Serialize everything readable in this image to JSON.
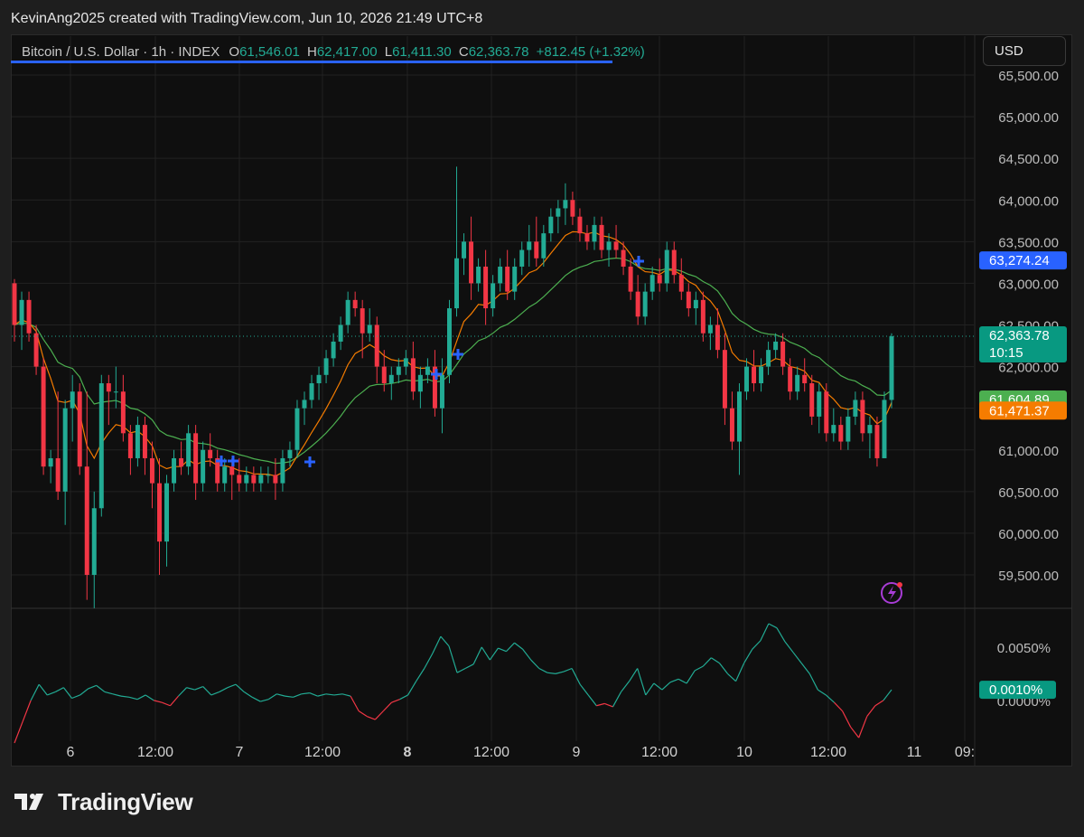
{
  "header": {
    "credit": "KevinAng2025 created with TradingView.com, Jun 10, 2026 21:49 UTC+8"
  },
  "legend": {
    "symbol": "Bitcoin / U.S. Dollar · 1h · INDEX",
    "o_label": "O",
    "o_value": "61,546.01",
    "h_label": "H",
    "h_value": "62,417.00",
    "l_label": "L",
    "l_value": "61,411.30",
    "c_label": "C",
    "c_value": "62,363.78",
    "change": "+812.45 (+1.32%)"
  },
  "currency_button": "USD",
  "brand": "TradingView",
  "chart_data": [
    {
      "type": "candlestick",
      "title": "Bitcoin / U.S. Dollar · 1h · INDEX",
      "y_ticks": [
        "65,500.00",
        "65,000.00",
        "64,500.00",
        "64,000.00",
        "63,500.00",
        "63,000.00",
        "62,500.00",
        "62,000.00",
        "61,500.00",
        "61,000.00",
        "60,500.00",
        "60,000.00",
        "59,500.00"
      ],
      "x_ticks": [
        "6",
        "12:00",
        "7",
        "12:00",
        "8",
        "12:00",
        "9",
        "12:00",
        "10",
        "12:00",
        "11",
        "09:"
      ],
      "ylim": [
        59200,
        65600
      ],
      "price_tags": [
        {
          "label": "63,274.24",
          "value": 63274.24,
          "color": "#2962ff"
        },
        {
          "label": "62,363.78",
          "sub": "10:15",
          "value": 62363.78,
          "color": "#089981"
        },
        {
          "label": "61,604.89",
          "value": 61604.89,
          "color": "#4caf50"
        },
        {
          "label": "61,471.37",
          "value": 61471.37,
          "color": "#f57c00"
        }
      ],
      "colors": {
        "up": "#22ab94",
        "down": "#f23645",
        "ma_fast": "#f57c00",
        "ma_slow": "#4caf50",
        "cross": "#2962ff"
      },
      "candles": [
        [
          63000,
          63050,
          62300,
          62500
        ],
        [
          62500,
          62900,
          62200,
          62800
        ],
        [
          62800,
          62900,
          62300,
          62400
        ],
        [
          62400,
          62500,
          61900,
          62000
        ],
        [
          62000,
          62100,
          60700,
          60800
        ],
        [
          60800,
          61000,
          60600,
          60900
        ],
        [
          60900,
          61700,
          60400,
          60500
        ],
        [
          60500,
          61600,
          60100,
          61500
        ],
        [
          61500,
          61900,
          61100,
          61700
        ],
        [
          61700,
          61800,
          60700,
          60800
        ],
        [
          60800,
          61700,
          59200,
          59500
        ],
        [
          59500,
          60500,
          59100,
          60300
        ],
        [
          60300,
          61900,
          60200,
          61800
        ],
        [
          61800,
          61900,
          61300,
          61700
        ],
        [
          61700,
          62000,
          61500,
          61700
        ],
        [
          61700,
          61900,
          61100,
          61200
        ],
        [
          61200,
          61300,
          60700,
          60900
        ],
        [
          60900,
          61400,
          60800,
          61300
        ],
        [
          61300,
          61400,
          60700,
          60900
        ],
        [
          60900,
          61100,
          60300,
          60600
        ],
        [
          60600,
          60900,
          59500,
          59900
        ],
        [
          59900,
          60700,
          59600,
          60600
        ],
        [
          60600,
          61000,
          60500,
          60900
        ],
        [
          60900,
          61100,
          60700,
          60800
        ],
        [
          60800,
          61300,
          60700,
          61200
        ],
        [
          61200,
          61300,
          60400,
          60600
        ],
        [
          60600,
          61100,
          60500,
          61000
        ],
        [
          61000,
          61200,
          60800,
          60900
        ],
        [
          60900,
          61000,
          60500,
          60600
        ],
        [
          60600,
          60900,
          60500,
          60800
        ],
        [
          60800,
          60900,
          60400,
          60700
        ],
        [
          60700,
          60900,
          60500,
          60600
        ],
        [
          60600,
          60800,
          60500,
          60700
        ],
        [
          60700,
          60800,
          60500,
          60600
        ],
        [
          60600,
          60800,
          60500,
          60700
        ],
        [
          60700,
          60800,
          60600,
          60700
        ],
        [
          60700,
          60900,
          60400,
          60600
        ],
        [
          60600,
          61000,
          60500,
          60900
        ],
        [
          60900,
          61100,
          60800,
          61000
        ],
        [
          61000,
          61600,
          60900,
          61500
        ],
        [
          61500,
          61700,
          61300,
          61600
        ],
        [
          61600,
          61900,
          61500,
          61800
        ],
        [
          61800,
          62000,
          61600,
          61900
        ],
        [
          61900,
          62200,
          61800,
          62100
        ],
        [
          62100,
          62400,
          62000,
          62300
        ],
        [
          62300,
          62600,
          62200,
          62500
        ],
        [
          62500,
          62900,
          62400,
          62800
        ],
        [
          62800,
          62900,
          62600,
          62700
        ],
        [
          62700,
          62800,
          62100,
          62400
        ],
        [
          62400,
          62700,
          62300,
          62500
        ],
        [
          62500,
          62600,
          61800,
          62000
        ],
        [
          62000,
          62200,
          61700,
          61800
        ],
        [
          61800,
          62000,
          61600,
          61900
        ],
        [
          61900,
          62100,
          61800,
          62000
        ],
        [
          62000,
          62200,
          61900,
          62100
        ],
        [
          62100,
          62300,
          61600,
          61700
        ],
        [
          61700,
          62000,
          61500,
          61900
        ],
        [
          61900,
          62100,
          61800,
          62000
        ],
        [
          62000,
          62200,
          61400,
          61500
        ],
        [
          61500,
          62100,
          61200,
          61900
        ],
        [
          61900,
          62800,
          61800,
          62700
        ],
        [
          62700,
          64400,
          62600,
          63300
        ],
        [
          63300,
          63600,
          63100,
          63500
        ],
        [
          63500,
          63800,
          62800,
          63000
        ],
        [
          63000,
          63300,
          62900,
          63200
        ],
        [
          63200,
          63400,
          62500,
          62700
        ],
        [
          62700,
          63100,
          62600,
          63000
        ],
        [
          63000,
          63300,
          62900,
          63200
        ],
        [
          63200,
          63400,
          62800,
          62900
        ],
        [
          62900,
          63300,
          62800,
          63200
        ],
        [
          63200,
          63500,
          63100,
          63400
        ],
        [
          63400,
          63700,
          63200,
          63500
        ],
        [
          63500,
          63800,
          63200,
          63300
        ],
        [
          63300,
          63700,
          63200,
          63600
        ],
        [
          63600,
          63900,
          63500,
          63800
        ],
        [
          63800,
          64000,
          63600,
          63900
        ],
        [
          63900,
          64200,
          63700,
          64000
        ],
        [
          64000,
          64100,
          63700,
          63800
        ],
        [
          63800,
          63900,
          63500,
          63600
        ],
        [
          63600,
          63700,
          63400,
          63500
        ],
        [
          63500,
          63800,
          63400,
          63700
        ],
        [
          63700,
          63800,
          63300,
          63400
        ],
        [
          63400,
          63600,
          63200,
          63500
        ],
        [
          63500,
          63700,
          63300,
          63400
        ],
        [
          63400,
          63500,
          63100,
          63200
        ],
        [
          63200,
          63300,
          62800,
          62900
        ],
        [
          62900,
          63100,
          62500,
          62600
        ],
        [
          62600,
          63000,
          62500,
          62900
        ],
        [
          62900,
          63200,
          62800,
          63100
        ],
        [
          63100,
          63300,
          62900,
          63000
        ],
        [
          63000,
          63500,
          62900,
          63400
        ],
        [
          63400,
          63500,
          63000,
          63100
        ],
        [
          63100,
          63300,
          62800,
          62900
        ],
        [
          62900,
          63000,
          62600,
          62700
        ],
        [
          62700,
          62900,
          62500,
          62800
        ],
        [
          62800,
          62900,
          62300,
          62400
        ],
        [
          62400,
          62600,
          62200,
          62500
        ],
        [
          62500,
          62700,
          62100,
          62200
        ],
        [
          62200,
          62400,
          61300,
          61500
        ],
        [
          61500,
          61700,
          61000,
          61100
        ],
        [
          61100,
          61800,
          60700,
          61700
        ],
        [
          61700,
          62100,
          61600,
          62000
        ],
        [
          62000,
          62200,
          61700,
          61800
        ],
        [
          61800,
          62100,
          61700,
          62000
        ],
        [
          62000,
          62300,
          61900,
          62200
        ],
        [
          62200,
          62400,
          62100,
          62300
        ],
        [
          62300,
          62400,
          61900,
          62000
        ],
        [
          62000,
          62100,
          61600,
          61700
        ],
        [
          61700,
          62000,
          61600,
          61900
        ],
        [
          61900,
          62100,
          61700,
          61800
        ],
        [
          61800,
          61900,
          61300,
          61400
        ],
        [
          61400,
          61800,
          61200,
          61700
        ],
        [
          61700,
          61800,
          61100,
          61200
        ],
        [
          61200,
          61500,
          61100,
          61300
        ],
        [
          61300,
          61400,
          61000,
          61100
        ],
        [
          61100,
          61500,
          61000,
          61400
        ],
        [
          61400,
          61700,
          61300,
          61600
        ],
        [
          61600,
          61700,
          61100,
          61200
        ],
        [
          61200,
          61400,
          60900,
          61300
        ],
        [
          61300,
          61400,
          60800,
          60900
        ],
        [
          60900,
          61700,
          60900,
          61600
        ],
        [
          61600,
          62400,
          61500,
          62363.78
        ]
      ],
      "ma_fast_last": 61471.37,
      "ma_slow_last": 61604.89
    },
    {
      "type": "line",
      "title": "",
      "y_ticks": [
        "0.0050%",
        "0.0000%"
      ],
      "current_tag": "0.0010%",
      "ylim": [
        -0.004,
        0.0072
      ],
      "values": [
        -0.004,
        -0.002,
        0.0,
        0.0015,
        0.0005,
        0.0008,
        0.0012,
        0.0002,
        0.0005,
        0.0011,
        0.0014,
        0.0008,
        0.0006,
        0.0004,
        0.0003,
        0.0001,
        0.0005,
        0.0,
        -0.0002,
        -0.0005,
        0.0004,
        0.0012,
        0.001,
        0.0013,
        0.0005,
        0.0008,
        0.0012,
        0.0015,
        0.0008,
        0.0003,
        -0.0001,
        0.0001,
        0.0006,
        0.0004,
        0.0003,
        0.0006,
        0.0007,
        0.0004,
        0.0006,
        0.0005,
        0.0006,
        0.0004,
        -0.001,
        -0.0015,
        -0.0018,
        -0.001,
        -0.0002,
        0.0001,
        0.0005,
        0.0018,
        0.003,
        0.0044,
        0.006,
        0.0051,
        0.0026,
        0.003,
        0.0034,
        0.005,
        0.0038,
        0.0049,
        0.0046,
        0.0054,
        0.0048,
        0.0038,
        0.003,
        0.0026,
        0.0025,
        0.0027,
        0.003,
        0.0015,
        0.0005,
        -0.0005,
        -0.0003,
        -0.0006,
        0.0008,
        0.0018,
        0.003,
        0.0005,
        0.0016,
        0.001,
        0.0017,
        0.002,
        0.0016,
        0.0028,
        0.0032,
        0.004,
        0.0035,
        0.0025,
        0.0018,
        0.0035,
        0.0048,
        0.0056,
        0.0072,
        0.0068,
        0.0055,
        0.0045,
        0.0035,
        0.0025,
        0.001,
        0.0005,
        -0.0002,
        -0.001,
        -0.0025,
        -0.0035,
        -0.0015,
        -0.0005,
        0.0,
        0.001
      ]
    }
  ],
  "icons": {
    "flash": "flash-icon",
    "logo": "tradingview-logo-icon"
  }
}
